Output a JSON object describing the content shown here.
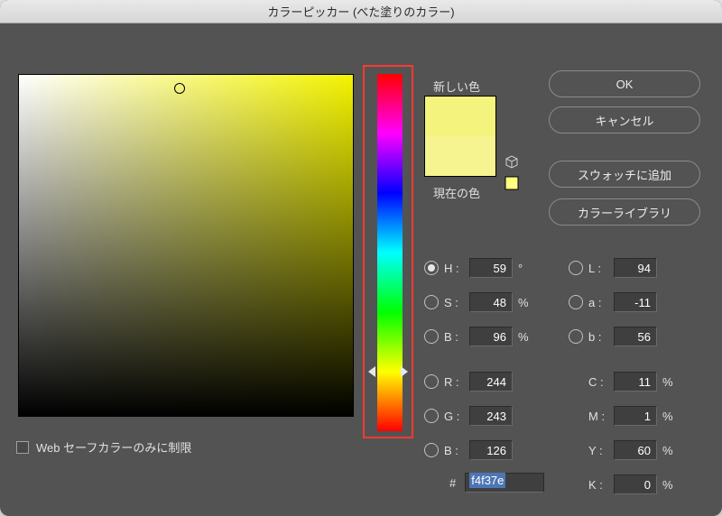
{
  "title": "カラーピッカー (べた塗りのカラー)",
  "buttons": {
    "ok": "OK",
    "cancel": "キャンセル",
    "add_swatch": "スウォッチに追加",
    "library": "カラーライブラリ"
  },
  "swatch": {
    "new_label": "新しい色",
    "current_label": "現在の色",
    "icon_cube": "cube-icon",
    "icon_square": "square-icon"
  },
  "hsb": {
    "h_label": "H :",
    "h": "59",
    "h_unit": "°",
    "h_selected": true,
    "s_label": "S :",
    "s": "48",
    "s_unit": "%",
    "b_label": "B :",
    "b": "96",
    "b_unit": "%"
  },
  "rgb": {
    "r_label": "R :",
    "r": "244",
    "g_label": "G :",
    "g": "243",
    "b_label": "B :",
    "b": "126"
  },
  "lab": {
    "l_label": "L :",
    "l": "94",
    "a_label": "a :",
    "a": "-11",
    "b_label": "b :",
    "b": "56"
  },
  "cmyk": {
    "c_label": "C :",
    "c": "11",
    "c_unit": "%",
    "m_label": "M :",
    "m": "1",
    "m_unit": "%",
    "y_label": "Y :",
    "y": "60",
    "y_unit": "%",
    "k_label": "K :",
    "k": "0",
    "k_unit": "%"
  },
  "hex": {
    "prefix": "#",
    "value": "f4f37e"
  },
  "websafe_label": "Web セーフカラーのみに制限",
  "colors": {
    "hue_highlight": "#ff3a30",
    "swatch_new": "#f4f37e",
    "swatch_current": "#f6f491"
  },
  "sv_cursor": {
    "left_pct": 48,
    "top_pct": 4
  },
  "hue_pos_pct": 83.4
}
